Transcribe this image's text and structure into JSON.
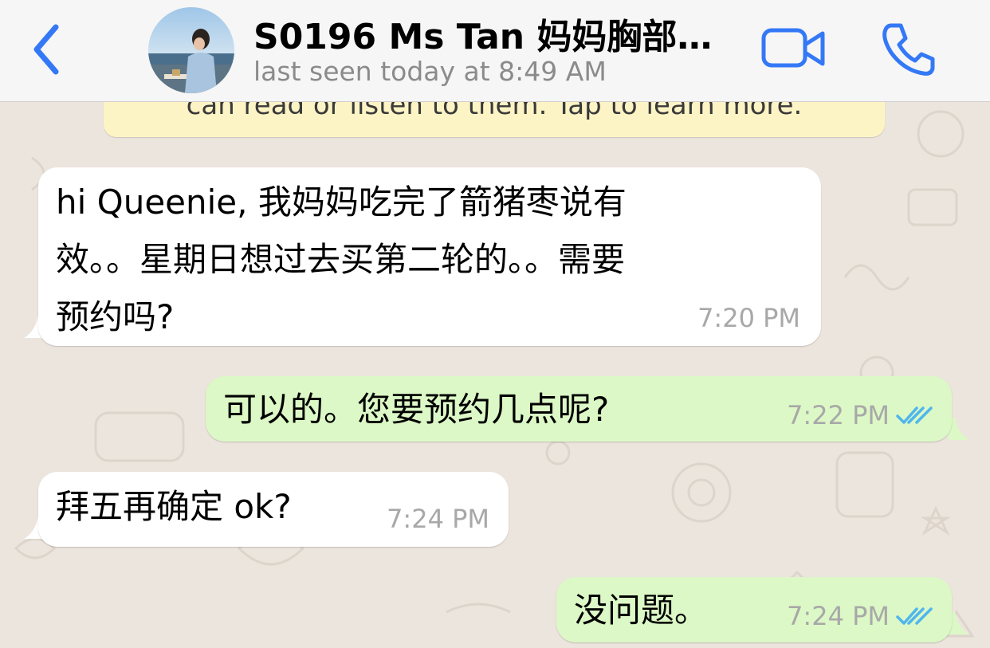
{
  "header": {
    "back_icon": "chevron-left-icon",
    "contact_name": "S0196 Ms Tan 妈妈胸部…",
    "last_seen": "last seen today at 8:49 AM",
    "video_icon": "video-camera-icon",
    "call_icon": "phone-icon",
    "accent_color": "#3478f6"
  },
  "chat": {
    "notice_text": "can read or listen to them. Tap to learn more.",
    "messages": [
      {
        "direction": "incoming",
        "lines": [
          "hi Queenie, 我妈妈吃完了箭猪枣说有",
          "效。。星期日想过去买第二轮的。。需要",
          "预约吗?"
        ],
        "time": "7:20 PM"
      },
      {
        "direction": "outgoing",
        "lines": [
          "可以的。您要预约几点呢?"
        ],
        "time": "7:22 PM",
        "status": "read"
      },
      {
        "direction": "incoming",
        "lines": [
          "拜五再确定 ok?"
        ],
        "time": "7:24 PM"
      },
      {
        "direction": "outgoing",
        "lines": [
          "没问题。"
        ],
        "time": "7:24 PM",
        "status": "read"
      }
    ],
    "colors": {
      "incoming_bubble": "#ffffff",
      "outgoing_bubble": "#dcf8c6",
      "read_ticks": "#4fb6ec",
      "wallpaper": "#ece5dd"
    }
  }
}
